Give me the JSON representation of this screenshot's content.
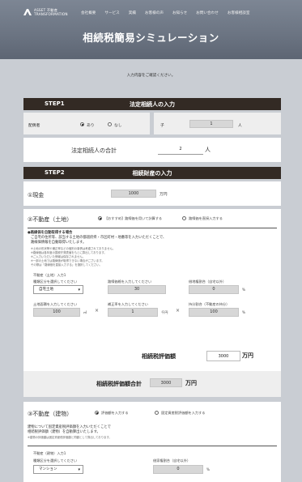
{
  "header": {
    "logo_line1": "ASSET",
    "logo_line2": "TRANSFORMATION",
    "logo_line3": "不動産",
    "nav": [
      "会社概要",
      "サービス",
      "実績",
      "お客様の声",
      "お知らせ",
      "お問い合わせ",
      "お客様相談室"
    ]
  },
  "page_title": "相続税簡易シミュレーション",
  "intro": "入力内容をご確認ください。",
  "step1": {
    "step": "STEP1",
    "title": "法定相続人の入力",
    "spouse_label": "配偶者",
    "spouse_yes": "あり",
    "spouse_no": "なし",
    "children_label": "子",
    "children_value": "1",
    "children_unit": "人",
    "total_label": "法定相続人の合計",
    "total_value": "2",
    "total_unit": "人"
  },
  "step2": {
    "step": "STEP2",
    "title": "相続財産の入力",
    "cash_label": "①現金",
    "cash_value": "1000",
    "cash_unit": "万円",
    "land": {
      "label": "②不動産（土地）",
      "opt_a": "【おすすめ】路線価を用いて計算する",
      "opt_b": "路線価を直接入力する",
      "note_title": "●路線価を自動取得する場合",
      "note_1": "ご自宅の住所等、該当する土地の都道府県・市区町村・地番等を入力いただくことで、",
      "note_2": "路線価情報を自動取得いたします。",
      "note_3": "※土地の形状等や補正率などの個別の事情は考慮されておりません。",
      "note_4": "※路線価は各年度の国税庁発表値をもとに算出しております。",
      "note_5": "※ご入力いただいた情報は保存されません。",
      "note_6": "※一部の土地では路線価が取得できない場合がございます。",
      "note_7": "その際は「路線価を直接入力する」を選択してください。",
      "sub_label": "不動産（土地）入力1",
      "type_label": "種類区分を選択してください",
      "type_value": "自宅土地",
      "price_label": "路線価格を入力してください",
      "price_value": "30",
      "ratio_label": "借地権割合（自宅以外）",
      "ratio_value": "0",
      "ratio_unit": "%",
      "area_label": "土地面積を入力してください",
      "area_value": "100",
      "area_unit": "㎡",
      "adj_label": "補正率を入力してください",
      "adj_value": "1",
      "adj_unit": "千円",
      "share_label": "持分割合（不動産の持分）",
      "share_value": "100",
      "share_unit": "%",
      "eval_label": "相続税評価額",
      "eval_value": "3000",
      "eval_unit": "万円"
    },
    "total_label": "相続税評価額合計",
    "total_value": "3000",
    "total_unit": "万円",
    "building": {
      "label": "③不動産（建物）",
      "opt_a": "評価額を入力する",
      "opt_b": "固定資産税評価額を入力する",
      "note_1": "建物について固定資産税評価額を入力いただくことで",
      "note_2": "相続税評価額（建物）を自動算出いたします。",
      "note_3": "※建物の評価額は固定資産税評価額と同額として算出しております。",
      "sub_label": "不動産（建物）入力1",
      "type_label": "種類区分を選択してください",
      "type_value": "マンション",
      "ratio_label": "借家権割合（自宅以外）",
      "ratio_value": "0",
      "ratio_unit": "%"
    }
  }
}
